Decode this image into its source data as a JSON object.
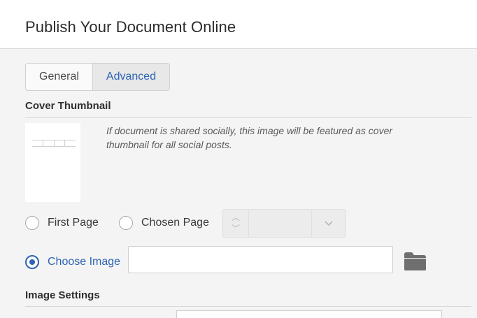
{
  "header": {
    "title": "Publish Your Document Online"
  },
  "tabs": [
    {
      "label": "General",
      "active": false
    },
    {
      "label": "Advanced",
      "active": true
    }
  ],
  "cover": {
    "section_title": "Cover Thumbnail",
    "description": "If document is shared socially, this image will be featured as cover thumbnail for all social posts.",
    "options": [
      {
        "label": "First Page",
        "checked": false
      },
      {
        "label": "Chosen Page",
        "checked": false
      },
      {
        "label": "Choose Image",
        "checked": true
      }
    ],
    "page_stepper": {
      "value": ""
    },
    "image_path": {
      "value": "",
      "placeholder": ""
    },
    "browse_icon": "folder-icon"
  },
  "image_settings": {
    "section_title": "Image Settings"
  },
  "colors": {
    "accent": "#2d64b3",
    "background": "#f4f4f4",
    "header": "#ffffff"
  }
}
